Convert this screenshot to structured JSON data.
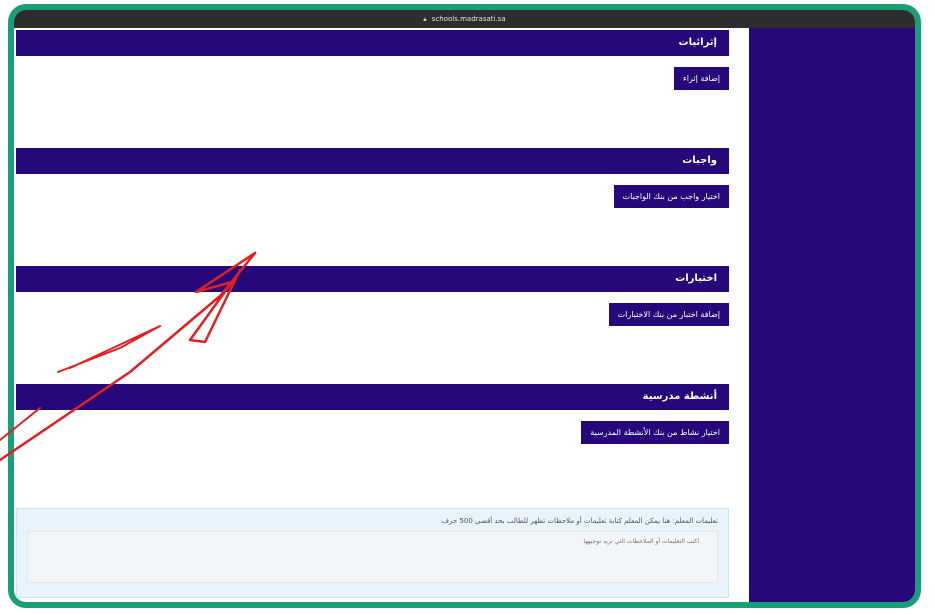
{
  "browser": {
    "url": "schools.madrasati.sa",
    "lock_icon": "lock-icon"
  },
  "sections": [
    {
      "title": "إثرائيات",
      "button": "إضافة إثراء"
    },
    {
      "title": "واجبات",
      "button": "اختيار واجب من بنك الواجبات"
    },
    {
      "title": "اختبارات",
      "button": "إضافة اختبار من بنك الاختبارات"
    },
    {
      "title": "أنشطة مدرسية",
      "button": "اختيار نشاط من بنك الأنشطة المدرسية"
    }
  ],
  "notes": {
    "label": "تعليمات المعلم: هنا يمكن المعلم كتابة تعليمات أو ملاحظات تظهر للطالب بحد أقصى 500 حرف",
    "placeholder": "اكتب التعليمات أو الملاحظات التي تريد توجيهها"
  },
  "colors": {
    "accent": "#26087a",
    "frame": "#1a9e78",
    "annotation": "#e02020"
  }
}
